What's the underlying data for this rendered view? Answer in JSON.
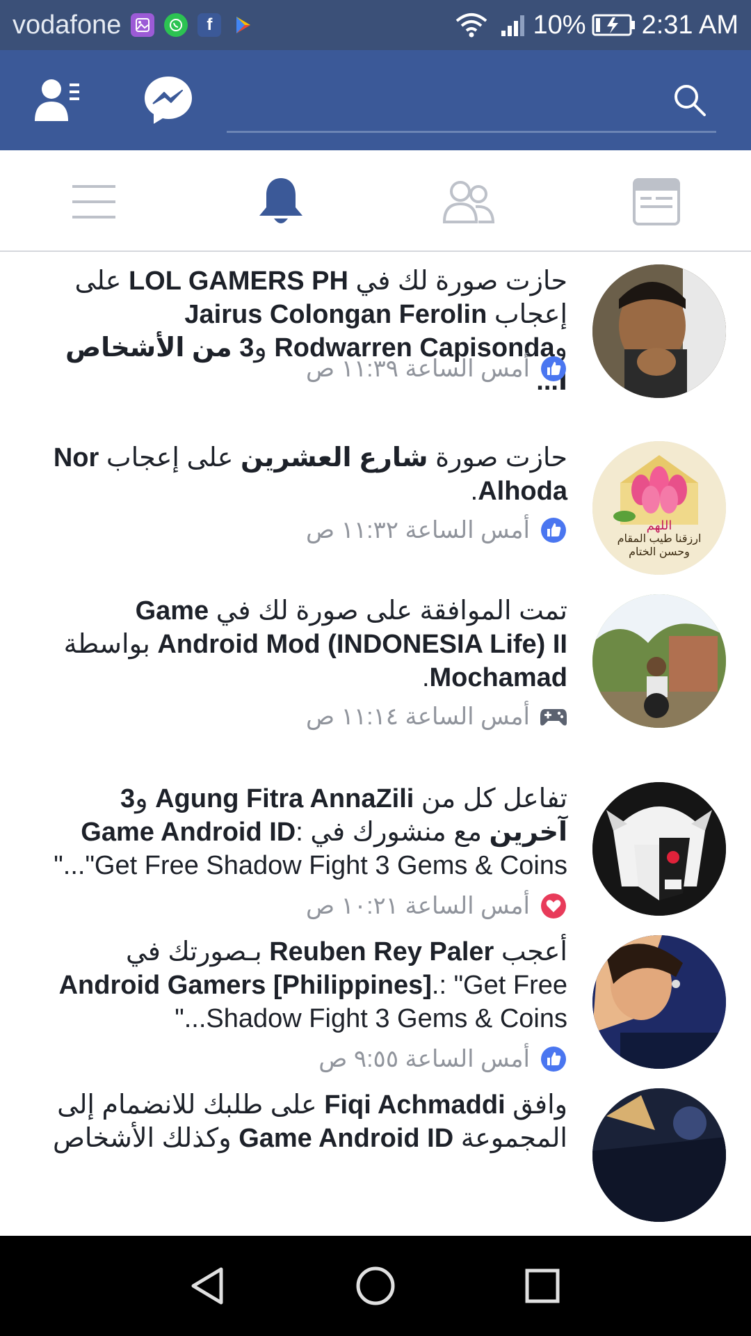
{
  "status_bar": {
    "carrier": "vodafone",
    "battery": "10%",
    "time": "2:31 AM",
    "icons": [
      "gallery-icon",
      "whatsapp-icon",
      "facebook-icon",
      "play-store-icon",
      "wifi-icon",
      "signal-icon",
      "battery-icon"
    ]
  },
  "topbar": {
    "search_placeholder": ""
  },
  "tabs": [
    {
      "name": "menu",
      "icon": "hamburger-icon",
      "active": false
    },
    {
      "name": "notifications",
      "icon": "bell-icon",
      "active": true
    },
    {
      "name": "friends",
      "icon": "friends-icon",
      "active": false
    },
    {
      "name": "news-feed",
      "icon": "news-feed-icon",
      "active": false
    }
  ],
  "notifications": [
    {
      "parts": [
        "حازت صورة لك في ",
        "LOL GAMERS PH",
        " على إعجاب ",
        "Jairus Colongan Ferolin",
        " و",
        "Rodwarren Capisonda",
        " و",
        "3 من الأشخاص ا...",
        ""
      ],
      "time": "أمس الساعة ١١:٣٩ ص",
      "reaction": "like-icon"
    },
    {
      "parts": [
        "حازت صورة ",
        "شارع العشرين",
        " على إعجاب ",
        "Nor Alhoda",
        "."
      ],
      "time": "أمس الساعة ١١:٣٢ ص",
      "reaction": "like-icon",
      "avatar_caption": [
        "اللهم",
        "ارزقنا طيب المقام",
        "وحسن الختام"
      ]
    },
    {
      "parts": [
        "تمت الموافقة على صورة لك في ",
        "Game Android Mod (INDONESIA Life) II",
        " بواسطة ",
        "Mochamad",
        "."
      ],
      "time": "أمس الساعة ١١:١٤ ص",
      "reaction": "game-controller-icon"
    },
    {
      "parts": [
        "تفاعل كل من ",
        "Agung Fitra AnnaZili",
        " و",
        "3 آخرين",
        " مع منشورك في ",
        "Game Android ID",
        ": \"Get Free Shadow Fight 3 Gems & Coins...\""
      ],
      "time": "أمس الساعة ١٠:٢١ ص",
      "reaction": "heart-icon"
    },
    {
      "parts": [
        "أعجب ",
        "Reuben Rey Paler",
        " بـصورتك في ",
        "Android Gamers [Philippines]",
        ".: \"Get Free Shadow Fight 3 Gems & Coins...\""
      ],
      "time": "أمس الساعة ٩:٥٥ ص",
      "reaction": "like-icon"
    },
    {
      "parts": [
        "وافق ",
        "Fiqi Achmaddi",
        " على طلبك للانضمام إلى المجموعة ",
        "Game Android ID",
        " وكذلك الأشخاص"
      ],
      "time": "",
      "reaction": ""
    }
  ],
  "colors": {
    "status_bar": "#3b5078",
    "facebook_blue": "#3b5998",
    "like_blue": "#4a76f0",
    "heart_red": "#e83b5a",
    "text": "#1d2129",
    "muted": "#90949c"
  }
}
